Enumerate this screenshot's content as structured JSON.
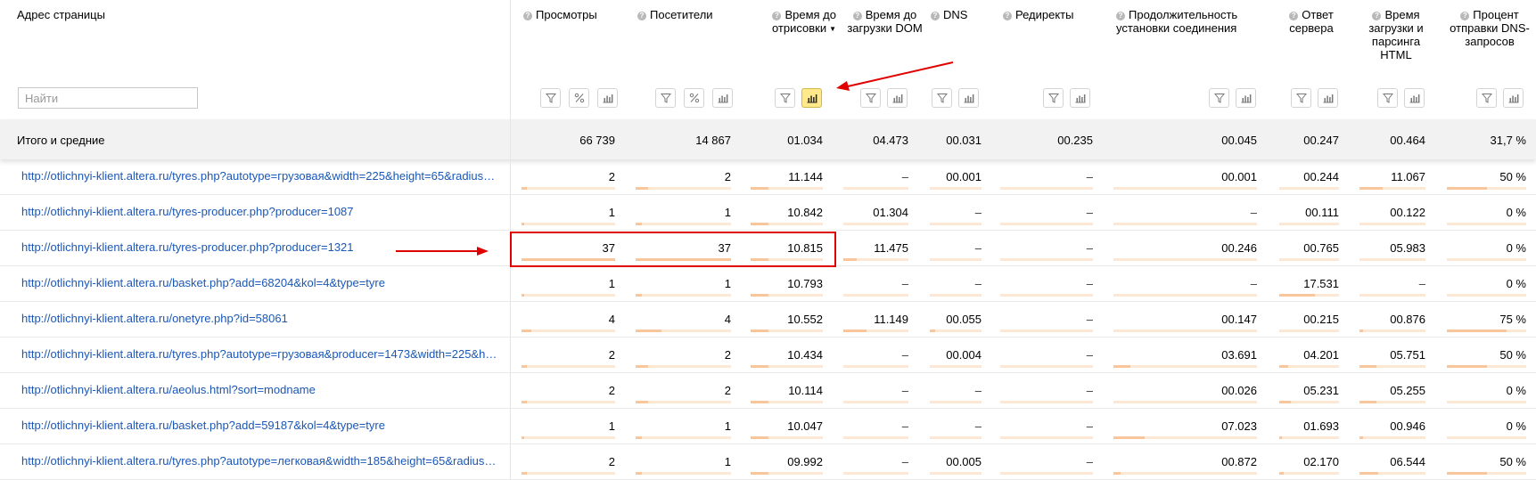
{
  "header": {
    "page_col": "Адрес страницы",
    "search_placeholder": "Найти",
    "columns": [
      {
        "key": "views",
        "title": "Просмотры"
      },
      {
        "key": "visitors",
        "title": "Посетители"
      },
      {
        "key": "render",
        "title": "Время до отрисовки",
        "sort": "▼"
      },
      {
        "key": "dom",
        "title": "Время до загрузки DOM"
      },
      {
        "key": "dns",
        "title": "DNS"
      },
      {
        "key": "redirects",
        "title": "Редиректы"
      },
      {
        "key": "conn",
        "title": "Продолжительность установки соединения"
      },
      {
        "key": "server",
        "title": "Ответ сервера"
      },
      {
        "key": "html",
        "title": "Время загрузки и парсинга HTML"
      },
      {
        "key": "dnsq",
        "title": "Процент отправки DNS-запросов"
      }
    ]
  },
  "totals": {
    "label": "Итого и средние",
    "values": [
      "66 739",
      "14 867",
      "01.034",
      "04.473",
      "00.031",
      "00.235",
      "00.045",
      "00.247",
      "00.464",
      "31,7 %"
    ]
  },
  "rows": [
    {
      "url": "http://otlichnyi-klient.altera.ru/tyres.php?autotype=грузовая&width=225&height=65&radius=…",
      "values": [
        "2",
        "2",
        "11.144",
        "–",
        "00.001",
        "–",
        "00.001",
        "00.244",
        "11.067",
        "50 %"
      ],
      "bars": [
        0.054,
        0.135,
        0.25,
        0,
        0,
        0,
        0,
        0,
        0.35,
        0.5
      ]
    },
    {
      "url": "http://otlichnyi-klient.altera.ru/tyres-producer.php?producer=1087",
      "values": [
        "1",
        "1",
        "10.842",
        "01.304",
        "–",
        "–",
        "–",
        "00.111",
        "00.122",
        "0 %"
      ],
      "bars": [
        0.027,
        0.068,
        0.25,
        0,
        0,
        0,
        0,
        0,
        0,
        0
      ]
    },
    {
      "url": "http://otlichnyi-klient.altera.ru/tyres-producer.php?producer=1321",
      "values": [
        "37",
        "37",
        "10.815",
        "11.475",
        "–",
        "–",
        "00.246",
        "00.765",
        "05.983",
        "0 %"
      ],
      "bars": [
        1,
        1,
        0.25,
        0.2,
        0,
        0,
        0,
        0,
        0,
        0
      ]
    },
    {
      "url": "http://otlichnyi-klient.altera.ru/basket.php?add=68204&kol=4&type=tyre",
      "values": [
        "1",
        "1",
        "10.793",
        "–",
        "–",
        "–",
        "–",
        "17.531",
        "–",
        "0 %"
      ],
      "bars": [
        0.027,
        0.068,
        0.25,
        0,
        0,
        0,
        0,
        0.6,
        0,
        0
      ]
    },
    {
      "url": "http://otlichnyi-klient.altera.ru/onetyre.php?id=58061",
      "values": [
        "4",
        "4",
        "10.552",
        "11.149",
        "00.055",
        "–",
        "00.147",
        "00.215",
        "00.876",
        "75 %"
      ],
      "bars": [
        0.108,
        0.27,
        0.25,
        0.35,
        0.1,
        0,
        0,
        0,
        0.05,
        0.75
      ]
    },
    {
      "url": "http://otlichnyi-klient.altera.ru/tyres.php?autotype=грузовая&producer=1473&width=225&h…",
      "values": [
        "2",
        "2",
        "10.434",
        "–",
        "00.004",
        "–",
        "03.691",
        "04.201",
        "05.751",
        "50 %"
      ],
      "bars": [
        0.054,
        0.135,
        0.25,
        0,
        0,
        0,
        0.12,
        0.15,
        0.25,
        0.5
      ]
    },
    {
      "url": "http://otlichnyi-klient.altera.ru/aeolus.html?sort=modname",
      "values": [
        "2",
        "2",
        "10.114",
        "–",
        "–",
        "–",
        "00.026",
        "05.231",
        "05.255",
        "0 %"
      ],
      "bars": [
        0.054,
        0.135,
        0.25,
        0,
        0,
        0,
        0,
        0.2,
        0.25,
        0
      ]
    },
    {
      "url": "http://otlichnyi-klient.altera.ru/basket.php?add=59187&kol=4&type=tyre",
      "values": [
        "1",
        "1",
        "10.047",
        "–",
        "–",
        "–",
        "07.023",
        "01.693",
        "00.946",
        "0 %"
      ],
      "bars": [
        0.027,
        0.068,
        0.25,
        0,
        0,
        0,
        0.22,
        0.05,
        0.05,
        0
      ]
    },
    {
      "url": "http://otlichnyi-klient.altera.ru/tyres.php?autotype=легковая&width=185&height=65&radius…",
      "values": [
        "2",
        "1",
        "09.992",
        "–",
        "00.005",
        "–",
        "00.872",
        "02.170",
        "06.544",
        "50 %"
      ],
      "bars": [
        0.054,
        0.068,
        0.25,
        0,
        0,
        0,
        0.05,
        0.08,
        0.28,
        0.5
      ]
    }
  ]
}
